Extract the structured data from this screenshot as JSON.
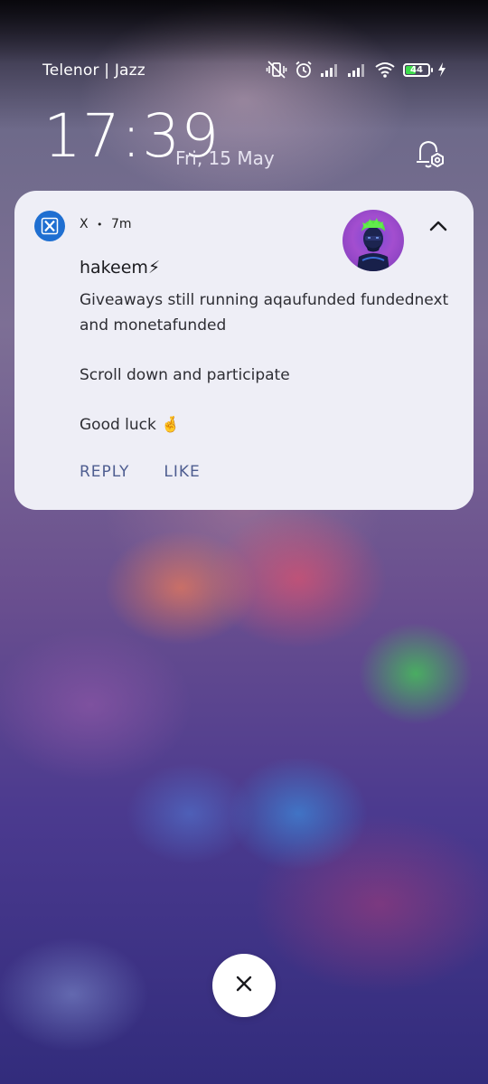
{
  "status_bar": {
    "carrier": "Telenor | Jazz",
    "battery_level": "44",
    "battery_fraction": 0.44,
    "battery_color": "#3ddc4c",
    "icons": [
      "vibrate-off-icon",
      "alarm-icon",
      "signal-icon",
      "signal-icon",
      "wifi-icon",
      "battery-icon",
      "charging-icon"
    ]
  },
  "lockscreen": {
    "time": "17:39",
    "date": "Fri, 15 May",
    "settings_icon": "notification-settings-icon"
  },
  "notification": {
    "app_icon": "x-logo-icon",
    "app_name": "X",
    "separator": "•",
    "age": "7m",
    "sender": "hakeem⚡",
    "lines": [
      "Giveaways still running aqaufunded fundednext and monetafunded",
      "Scroll down and participate",
      "Good luck 🤞"
    ],
    "actions": {
      "reply": "REPLY",
      "like": "LIKE"
    },
    "accent_color": "#1f6fd1",
    "action_color": "#4e5d90"
  },
  "dismiss": {
    "icon": "close-icon"
  }
}
